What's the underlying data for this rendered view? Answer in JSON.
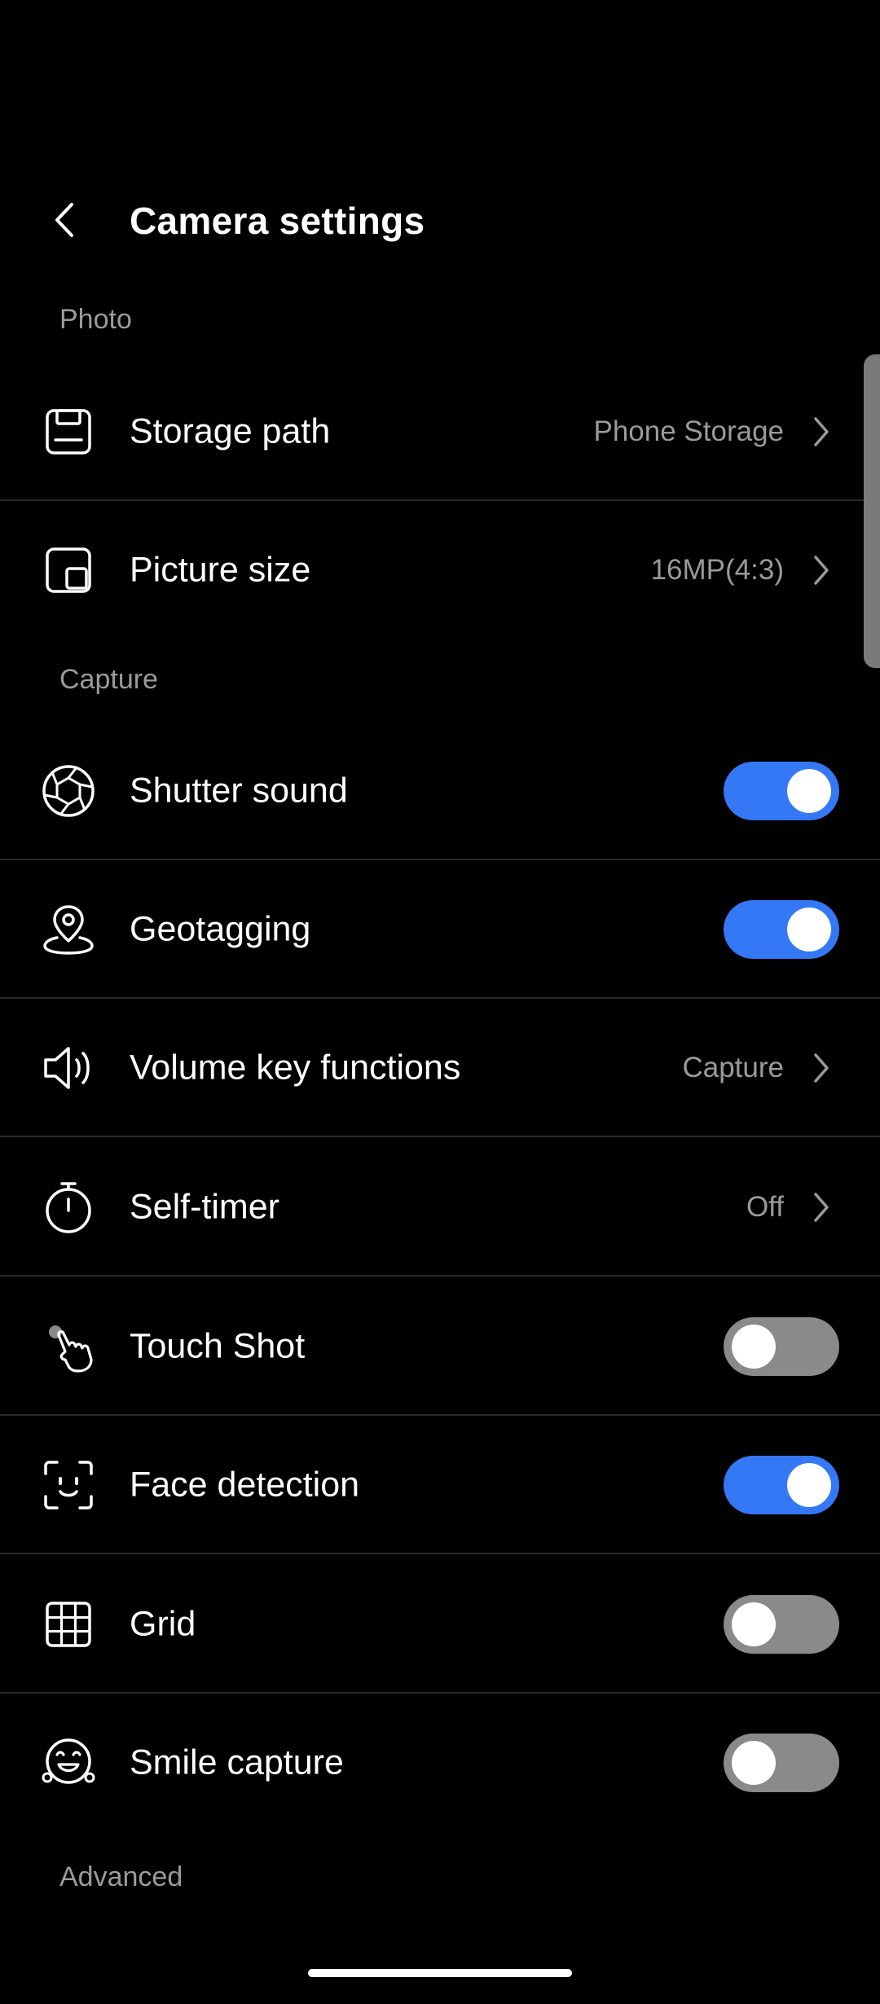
{
  "header": {
    "title": "Camera settings"
  },
  "sections": {
    "photo": "Photo",
    "capture": "Capture",
    "advanced": "Advanced"
  },
  "items": {
    "storage_path": {
      "label": "Storage path",
      "value": "Phone Storage",
      "icon": "storage-icon"
    },
    "picture_size": {
      "label": "Picture size",
      "value": "16MP(4:3)",
      "icon": "picture-size-icon"
    },
    "shutter_sound": {
      "label": "Shutter sound",
      "enabled": true,
      "icon": "shutter-icon"
    },
    "geotagging": {
      "label": "Geotagging",
      "enabled": true,
      "icon": "location-pin-icon"
    },
    "volume_key_functions": {
      "label": "Volume key functions",
      "value": "Capture",
      "icon": "speaker-icon"
    },
    "self_timer": {
      "label": "Self-timer",
      "value": "Off",
      "icon": "timer-icon"
    },
    "touch_shot": {
      "label": "Touch Shot",
      "enabled": false,
      "icon": "touch-hand-icon"
    },
    "face_detection": {
      "label": "Face detection",
      "enabled": true,
      "icon": "face-detection-icon"
    },
    "grid": {
      "label": "Grid",
      "enabled": false,
      "icon": "grid-icon"
    },
    "smile_capture": {
      "label": "Smile capture",
      "enabled": false,
      "icon": "smile-icon"
    }
  },
  "colors": {
    "background": "#000000",
    "accent": "#3478f6",
    "toggle_off": "#8a8a8a",
    "secondary_text": "#9a9a9a",
    "divider": "#2a2a2a"
  }
}
